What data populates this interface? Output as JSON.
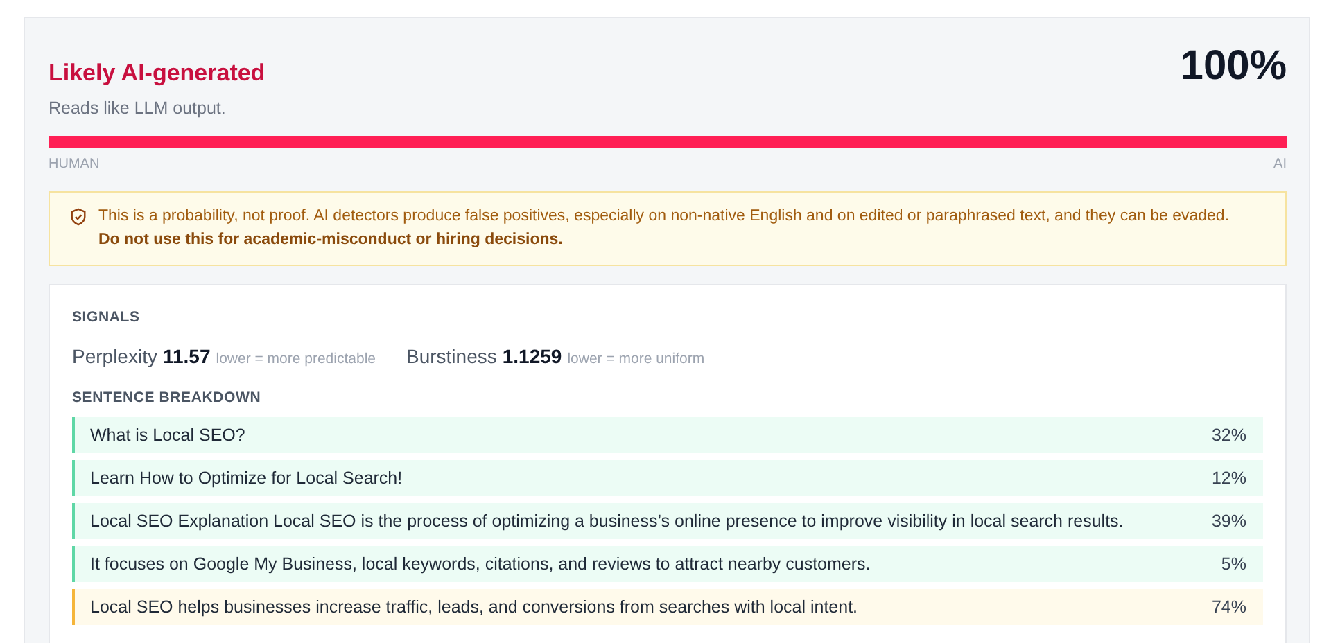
{
  "verdict": {
    "title": "Likely AI-generated",
    "subtitle": "Reads like LLM output.",
    "score": "100%",
    "level": 1,
    "left_label": "HUMAN",
    "right_label": "AI"
  },
  "warning": {
    "text": "This is a probability, not proof. AI detectors produce false positives, especially on non-native English and on edited or paraphrased text, and they can be evaded.",
    "emphasis": "Do not use this for academic-misconduct or hiring decisions."
  },
  "signals": {
    "heading": "SIGNALS",
    "items": [
      {
        "name": "Perplexity",
        "value": "11.57",
        "hint": "lower = more predictable"
      },
      {
        "name": "Burstiness",
        "value": "1.1259",
        "hint": "lower = more uniform"
      }
    ]
  },
  "breakdown": {
    "heading": "SENTENCE BREAKDOWN",
    "rows": [
      {
        "text": "What is Local SEO?",
        "score": "32%",
        "kind": "low"
      },
      {
        "text": "Learn How to Optimize for Local Search!",
        "score": "12%",
        "kind": "low"
      },
      {
        "text": "Local SEO Explanation Local SEO is the process of optimizing a business’s online presence to improve visibility in local search results.",
        "score": "39%",
        "kind": "low"
      },
      {
        "text": "It focuses on Google My Business, local keywords, citations, and reviews to attract nearby customers.",
        "score": "5%",
        "kind": "low"
      },
      {
        "text": "Local SEO helps businesses increase traffic, leads, and conversions from searches with local intent.",
        "score": "74%",
        "kind": "high"
      }
    ]
  }
}
